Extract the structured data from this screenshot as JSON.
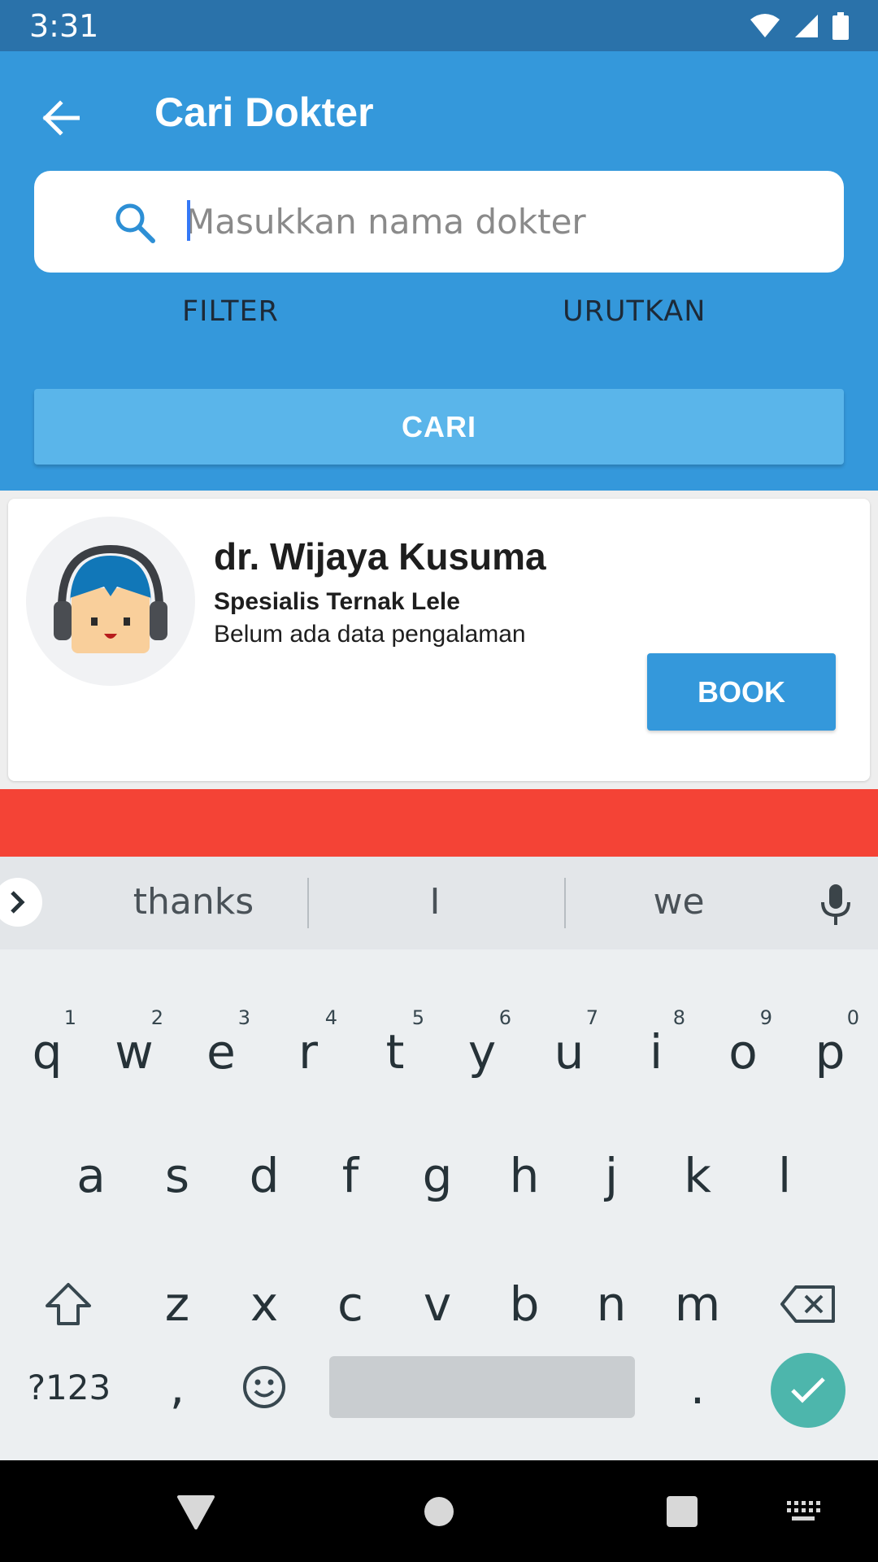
{
  "status_bar": {
    "time": "3:31",
    "icons": [
      "wifi-icon",
      "signal-icon",
      "battery-icon"
    ]
  },
  "header": {
    "title": "Cari Dokter",
    "back_icon": "arrow-left-icon"
  },
  "search": {
    "placeholder": "Masukkan nama dokter",
    "value": "",
    "icon": "search-icon"
  },
  "actions": {
    "filter_label": "FILTER",
    "sort_label": "URUTKAN",
    "search_button_label": "CARI"
  },
  "doctors": [
    {
      "name": "dr. Wijaya Kusuma",
      "specialty": "Spesialis Ternak Lele",
      "experience": "Belum ada data pengalaman",
      "book_label": "BOOK",
      "avatar_icon": "doctor-avatar-icon"
    }
  ],
  "keyboard": {
    "suggestions": [
      "thanks",
      "I",
      "we"
    ],
    "row1": [
      {
        "key": "q",
        "hint": "1"
      },
      {
        "key": "w",
        "hint": "2"
      },
      {
        "key": "e",
        "hint": "3"
      },
      {
        "key": "r",
        "hint": "4"
      },
      {
        "key": "t",
        "hint": "5"
      },
      {
        "key": "y",
        "hint": "6"
      },
      {
        "key": "u",
        "hint": "7"
      },
      {
        "key": "i",
        "hint": "8"
      },
      {
        "key": "o",
        "hint": "9"
      },
      {
        "key": "p",
        "hint": "0"
      }
    ],
    "row2": [
      "a",
      "s",
      "d",
      "f",
      "g",
      "h",
      "j",
      "k",
      "l"
    ],
    "row3": [
      "z",
      "x",
      "c",
      "v",
      "b",
      "n",
      "m"
    ],
    "symbols_label": "?123",
    "comma": ",",
    "period": "."
  },
  "colors": {
    "primary": "#3498db",
    "status_bar": "#2a72aa",
    "accent_red": "#f44336",
    "enter_key": "#4db6ac"
  }
}
